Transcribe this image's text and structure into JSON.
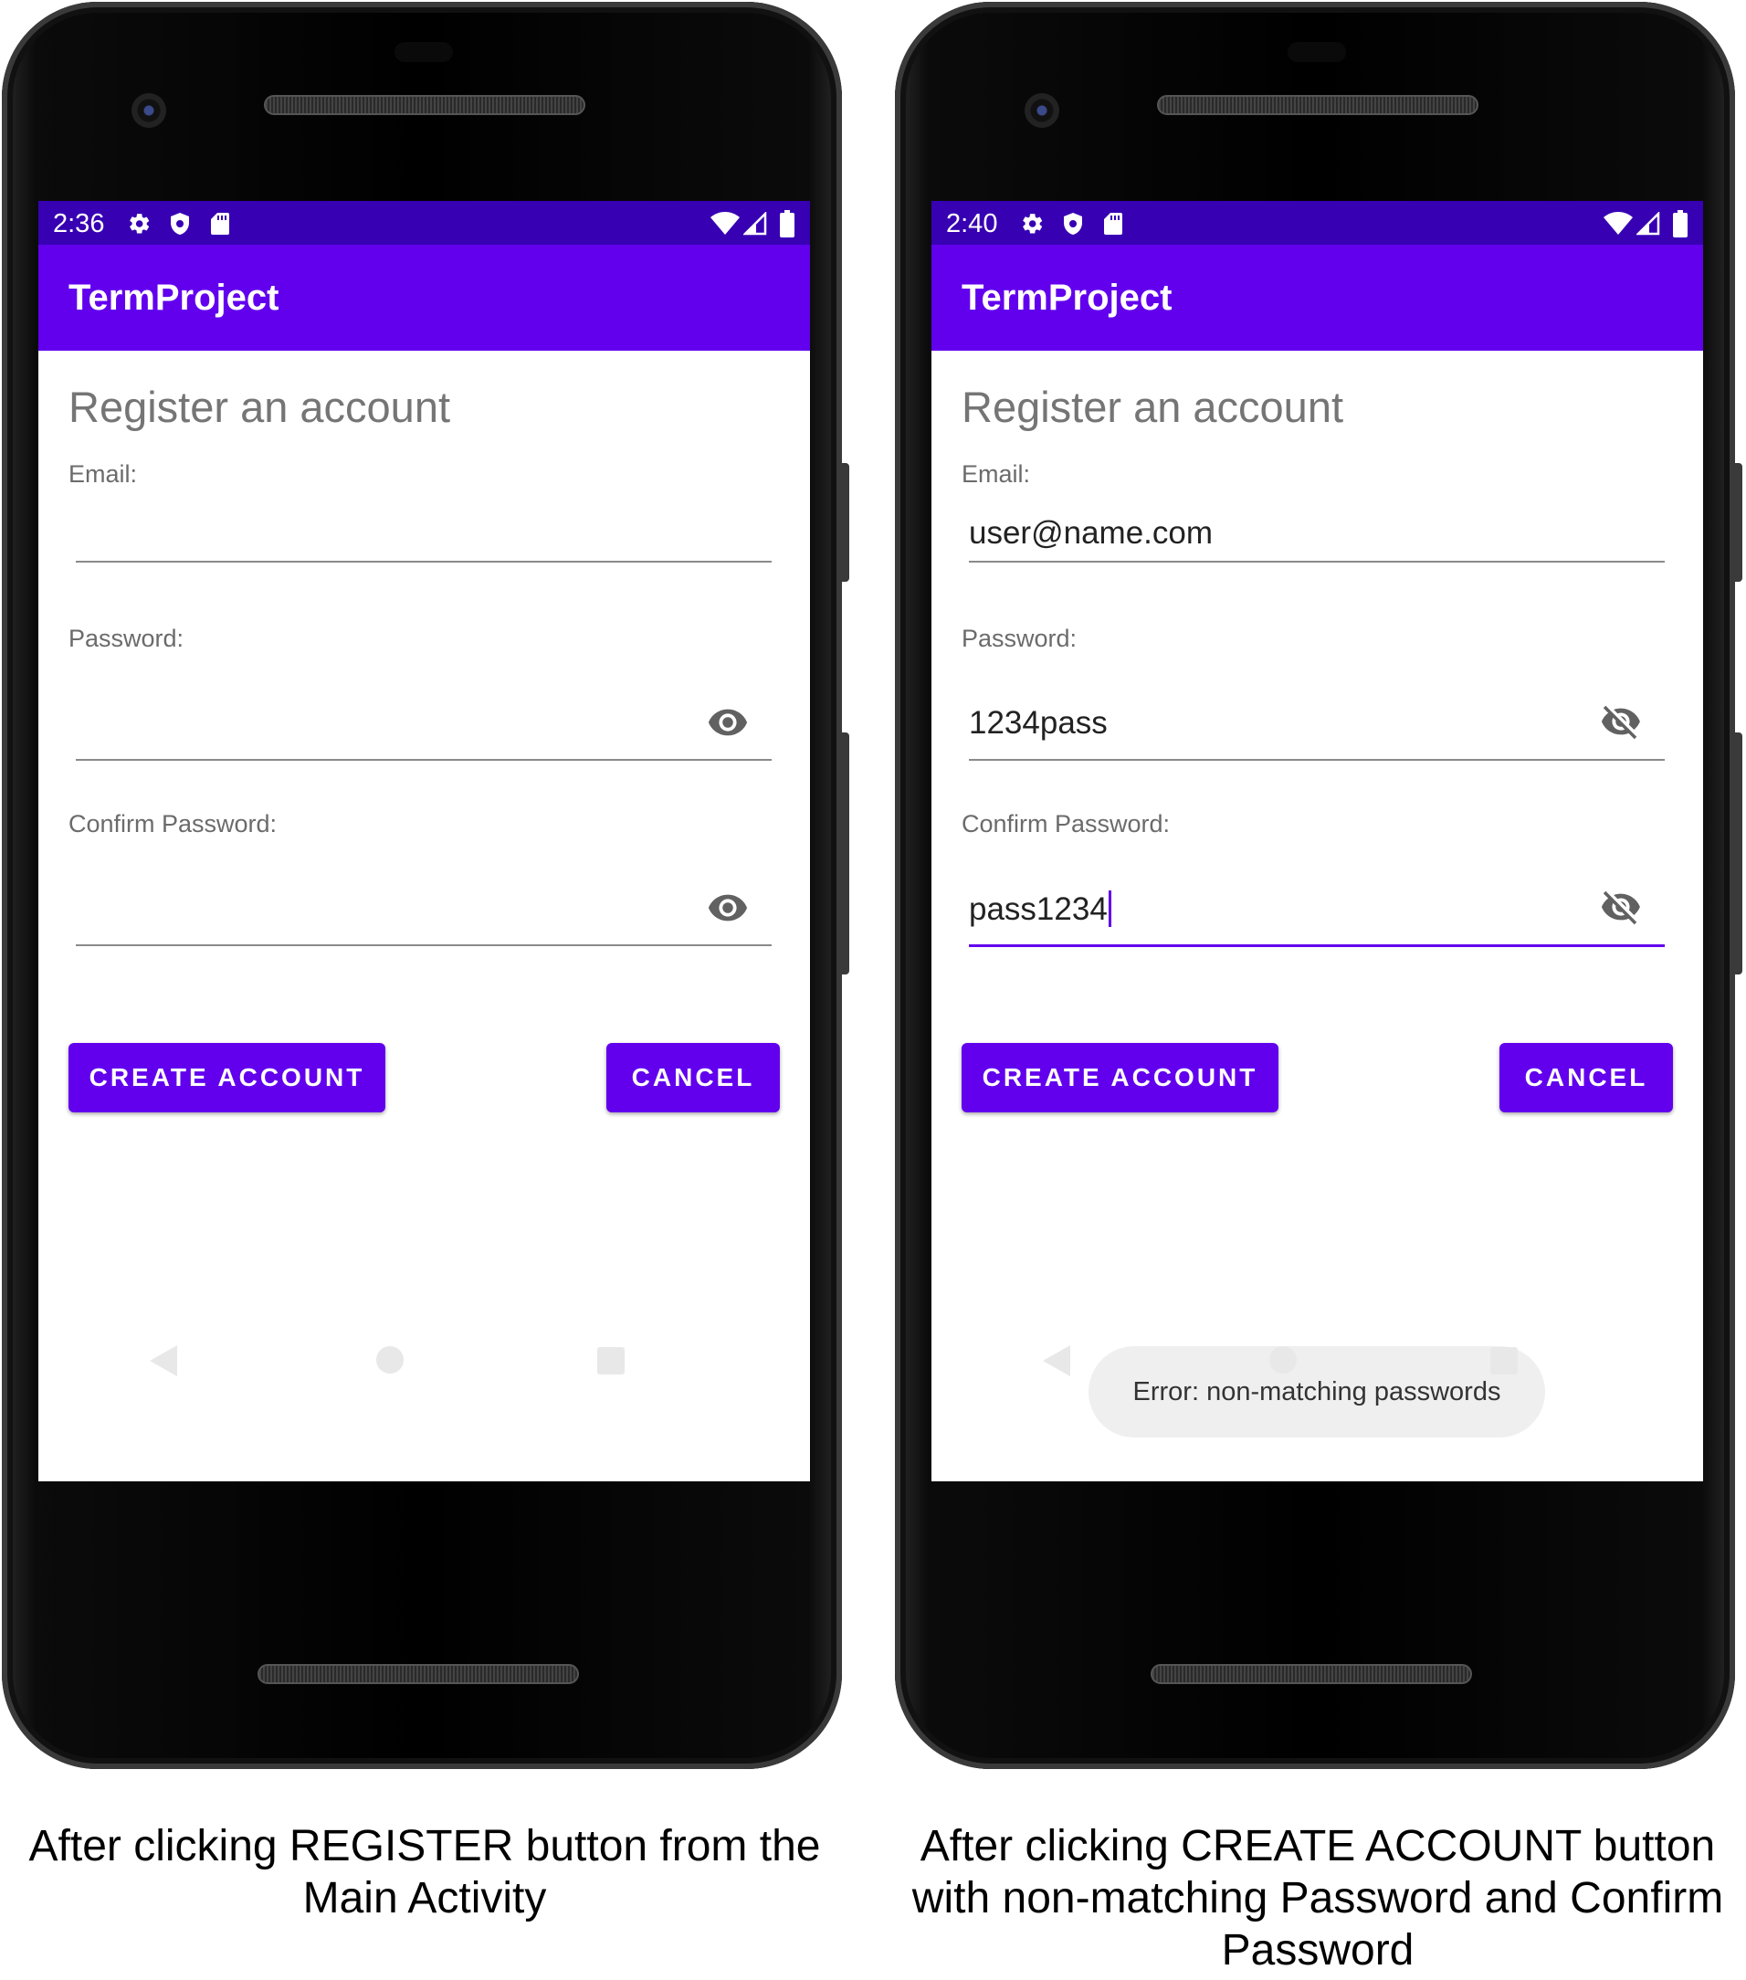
{
  "panels": [
    {
      "status_time": "2:36",
      "app_title": "TermProject",
      "heading": "Register an account",
      "email_label": "Email:",
      "email_value": "",
      "password_label": "Password:",
      "password_value": "",
      "confirm_label": "Confirm Password:",
      "confirm_value": "",
      "password_visibility_icon": "eye-icon",
      "create_button": "CREATE ACCOUNT",
      "cancel_button": "CANCEL",
      "caption": "After clicking REGISTER button from the Main Activity"
    },
    {
      "status_time": "2:40",
      "app_title": "TermProject",
      "heading": "Register an account",
      "email_label": "Email:",
      "email_value": "user@name.com",
      "password_label": "Password:",
      "password_value": "1234pass",
      "confirm_label": "Confirm Password:",
      "confirm_value": "pass1234",
      "password_visibility_icon": "eye-off-icon",
      "create_button": "CREATE ACCOUNT",
      "cancel_button": "CANCEL",
      "toast": "Error: non-matching passwords",
      "caption": "After clicking CREATE ACCOUNT button with non-matching Password and Confirm Password"
    }
  ],
  "colors": {
    "status_bar": "#3700b3",
    "app_bar": "#6200ee",
    "button": "#6200ee",
    "toast_bg": "#efefef"
  }
}
